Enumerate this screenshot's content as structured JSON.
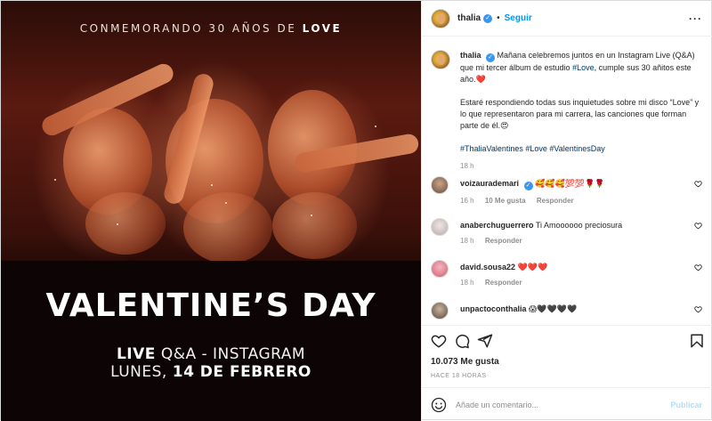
{
  "media": {
    "top_text_prefix": "CONMEMORANDO 30 AÑOS DE",
    "top_text_bold": "LOVE",
    "headline": "VALENTINE’S DAY",
    "line1_bold": "LIVE",
    "line1_rest": "Q&A - INSTAGRAM",
    "line2_prefix": "LUNES,",
    "line2_bold": "14 DE FEBRERO"
  },
  "header": {
    "username": "thalia",
    "separator": "•",
    "follow_label": "Seguir",
    "more_icon": "more-horizontal-icon",
    "more_glyph": "···"
  },
  "caption": {
    "username": "thalia",
    "text_1": "Mañana celebremos juntos en un Instagram Live (Q&A) que mi tercer álbum de estudio",
    "hashtag_love": "#Love",
    "text_1b": ", cumple sus 30 añitos este año.",
    "emoji_1": "❤️",
    "text_2": "Estaré respondiendo todas sus inquietudes sobre mi disco “Love” y lo que representaron para mi carrera, las canciones que forman parte de él.",
    "emoji_2": "😍",
    "hashtags": "#ThaliaValentines #Love #ValentinesDay",
    "time": "18 h"
  },
  "comments": [
    {
      "username": "voizaurademari",
      "verified": true,
      "text": "🥰🥰🥰💯💯🌹🌹",
      "time": "16 h",
      "likes": "10 Me gusta",
      "reply": "Responder"
    },
    {
      "username": "anaberchuguerrero",
      "verified": false,
      "text": "Ti Amoooooo preciosura",
      "time": "18 h",
      "likes": "",
      "reply": "Responder"
    },
    {
      "username": "david.sousa22",
      "verified": false,
      "text": "❤️❤️❤️",
      "time": "18 h",
      "likes": "",
      "reply": "Responder"
    },
    {
      "username": "unpactoconthalia",
      "verified": false,
      "text": "😱🖤🖤🖤🖤",
      "time": "",
      "likes": "",
      "reply": ""
    }
  ],
  "stats": {
    "likes": "10.073 Me gusta",
    "ago": "HACE 18 HORAS"
  },
  "composer": {
    "placeholder": "Añade un comentario...",
    "publish_label": "Publicar"
  },
  "colors": {
    "link": "#00376b",
    "follow": "#0095f6",
    "verified": "#3897f0",
    "publish_disabled": "#b2dffc",
    "muted": "#8e8e8e"
  }
}
